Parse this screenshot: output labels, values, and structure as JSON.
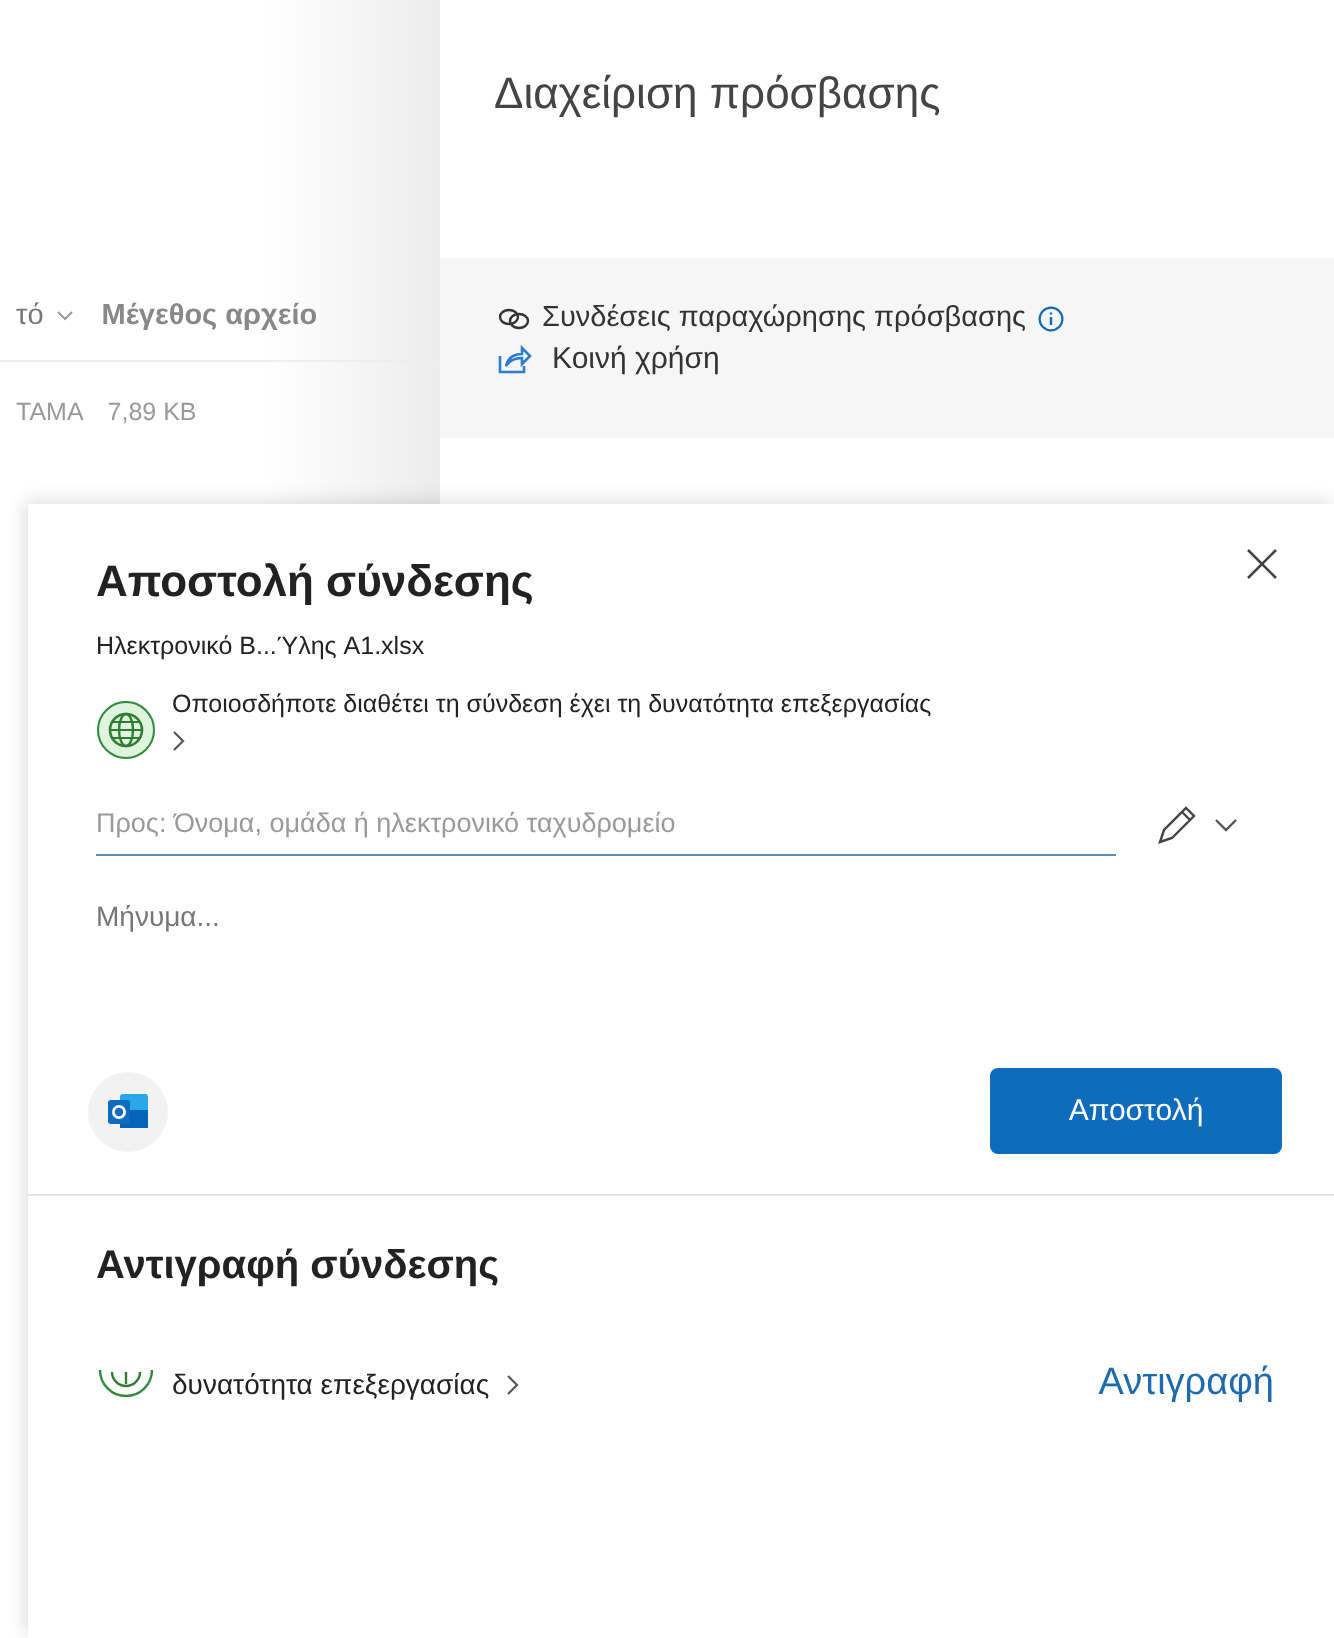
{
  "background_list": {
    "columns": [
      "τό",
      "Μέγεθος αρχείο"
    ],
    "rows": [
      {
        "cells": [
          "TAMA",
          "7,89 KB"
        ]
      }
    ]
  },
  "access_panel": {
    "title": "Διαχείριση πρόσβασης",
    "links": [
      {
        "kind": "links",
        "label": "Συνδέσεις παραχώρησης πρόσβασης"
      },
      {
        "kind": "share",
        "label": "Κοινή χρήση"
      }
    ]
  },
  "send_link": {
    "title": "Αποστολή σύνδεσης",
    "file_name": "Ηλεκτρονικό Β...Ύλης A1.xlsx",
    "permission": "Οποιοσδήποτε διαθέτει τη σύνδεση έχει τη δυνατότητα επεξεργασίας",
    "recipient_placeholder": "Προς: Όνομα, ομάδα ή ηλεκτρονικό ταχυδρομείο",
    "message_placeholder": "Μήνυμα...",
    "send_button": "Αποστολή"
  },
  "copy_link": {
    "title": "Αντιγραφή σύνδεσης",
    "permission": "δυνατότητα επεξεργασίας",
    "copy_button": "Αντιγραφή"
  }
}
